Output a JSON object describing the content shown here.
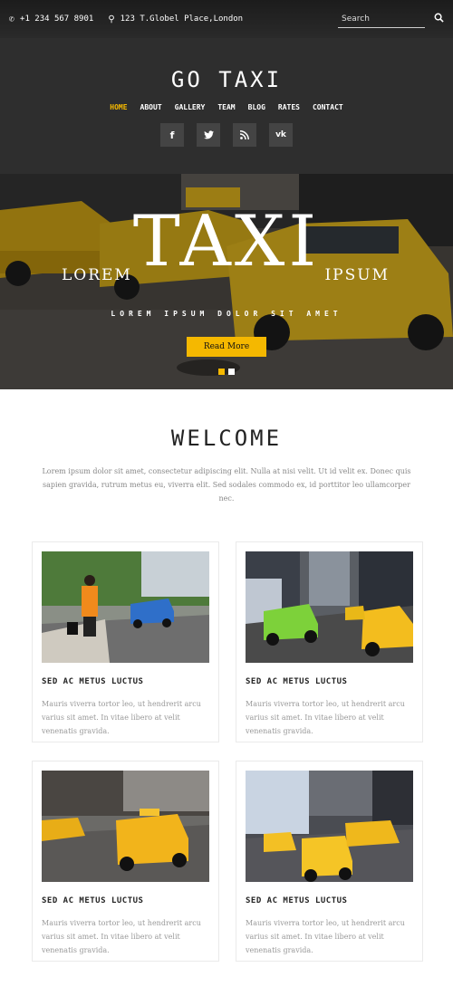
{
  "topbar": {
    "phone": "+1 234 567 8901",
    "address": "123 T.Globel Place,London",
    "search_placeholder": "Search"
  },
  "header": {
    "brand": "GO TAXI",
    "nav": [
      "HOME",
      "ABOUT",
      "GALLERY",
      "TEAM",
      "BLOG",
      "RATES",
      "CONTACT"
    ],
    "social": [
      "f",
      "t",
      "rss",
      "vk"
    ]
  },
  "hero": {
    "title": "TAXI",
    "left_word": "LOREM",
    "right_word": "IPSUM",
    "subtitle": "LOREM IPSUM DOLOR SIT AMET",
    "button": "Read More"
  },
  "welcome": {
    "title": "WELCOME",
    "text": "Lorem ipsum dolor sit amet, consectetur adipiscing elit. Nulla at nisi velit. Ut id velit ex. Donec quis sapien gravida, rutrum metus eu, viverra elit. Sed sodales commodo ex, id porttitor leo ullamcorper nec."
  },
  "cards": [
    {
      "title": "SED AC METUS LUCTUS",
      "text": "Mauris viverra tortor leo, ut hendrerit arcu varius sit amet. In vitae libero at velit venenatis gravida."
    },
    {
      "title": "SED AC METUS LUCTUS",
      "text": "Mauris viverra tortor leo, ut hendrerit arcu varius sit amet. In vitae libero at velit venenatis gravida."
    },
    {
      "title": "SED AC METUS LUCTUS",
      "text": "Mauris viverra tortor leo, ut hendrerit arcu varius sit amet. In vitae libero at velit venenatis gravida."
    },
    {
      "title": "SED AC METUS LUCTUS",
      "text": "Mauris viverra tortor leo, ut hendrerit arcu varius sit amet. In vitae libero at velit venenatis gravida."
    }
  ],
  "colors": {
    "accent": "#f5b800",
    "header_bg": "#2e2e2e",
    "topbar_bg": "#1c1c1c"
  }
}
